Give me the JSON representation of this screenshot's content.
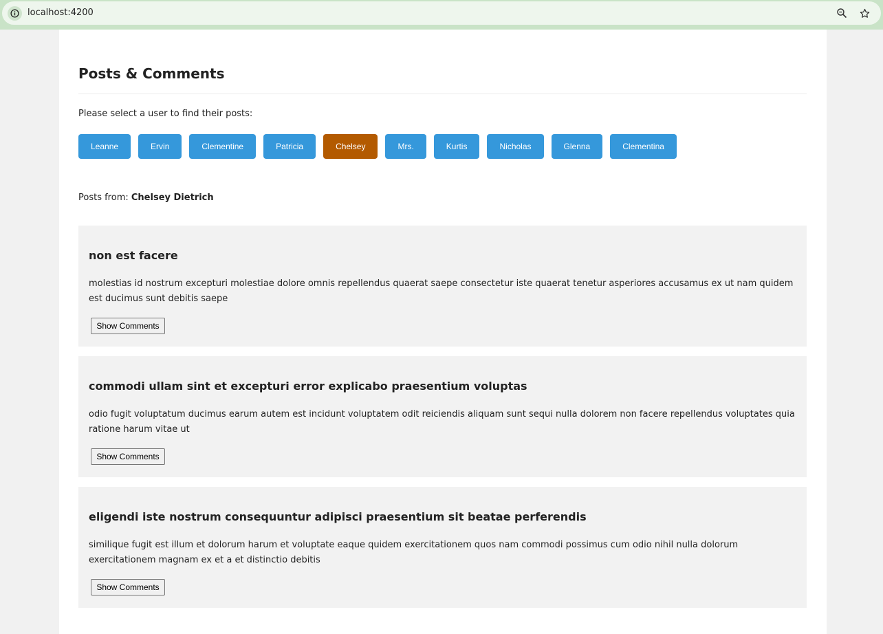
{
  "browser": {
    "url": "localhost:4200"
  },
  "page": {
    "title": "Posts & Comments",
    "prompt": "Please select a user to find their posts:",
    "users": [
      "Leanne",
      "Ervin",
      "Clementine",
      "Patricia",
      "Chelsey",
      "Mrs.",
      "Kurtis",
      "Nicholas",
      "Glenna",
      "Clementina"
    ],
    "selected_user": "Chelsey",
    "posts_from_label": "Posts from:",
    "posts_from_name": "Chelsey Dietrich",
    "show_comments_label": "Show Comments",
    "posts": [
      {
        "title": "non est facere",
        "body": "molestias id nostrum excepturi molestiae dolore omnis repellendus quaerat saepe consectetur iste quaerat tenetur asperiores accusamus ex ut nam quidem est ducimus sunt debitis saepe"
      },
      {
        "title": "commodi ullam sint et excepturi error explicabo praesentium voluptas",
        "body": "odio fugit voluptatum ducimus earum autem est incidunt voluptatem odit reiciendis aliquam sunt sequi nulla dolorem non facere repellendus voluptates quia ratione harum vitae ut"
      },
      {
        "title": "eligendi iste nostrum consequuntur adipisci praesentium sit beatae perferendis",
        "body": "similique fugit est illum et dolorum harum et voluptate eaque quidem exercitationem quos nam commodi possimus cum odio nihil nulla dolorum exercitationem magnam ex et a et distinctio debitis"
      }
    ]
  },
  "colors": {
    "button": "#3598db",
    "selected_button": "#b35a00",
    "post_background": "#f2f2f2"
  }
}
